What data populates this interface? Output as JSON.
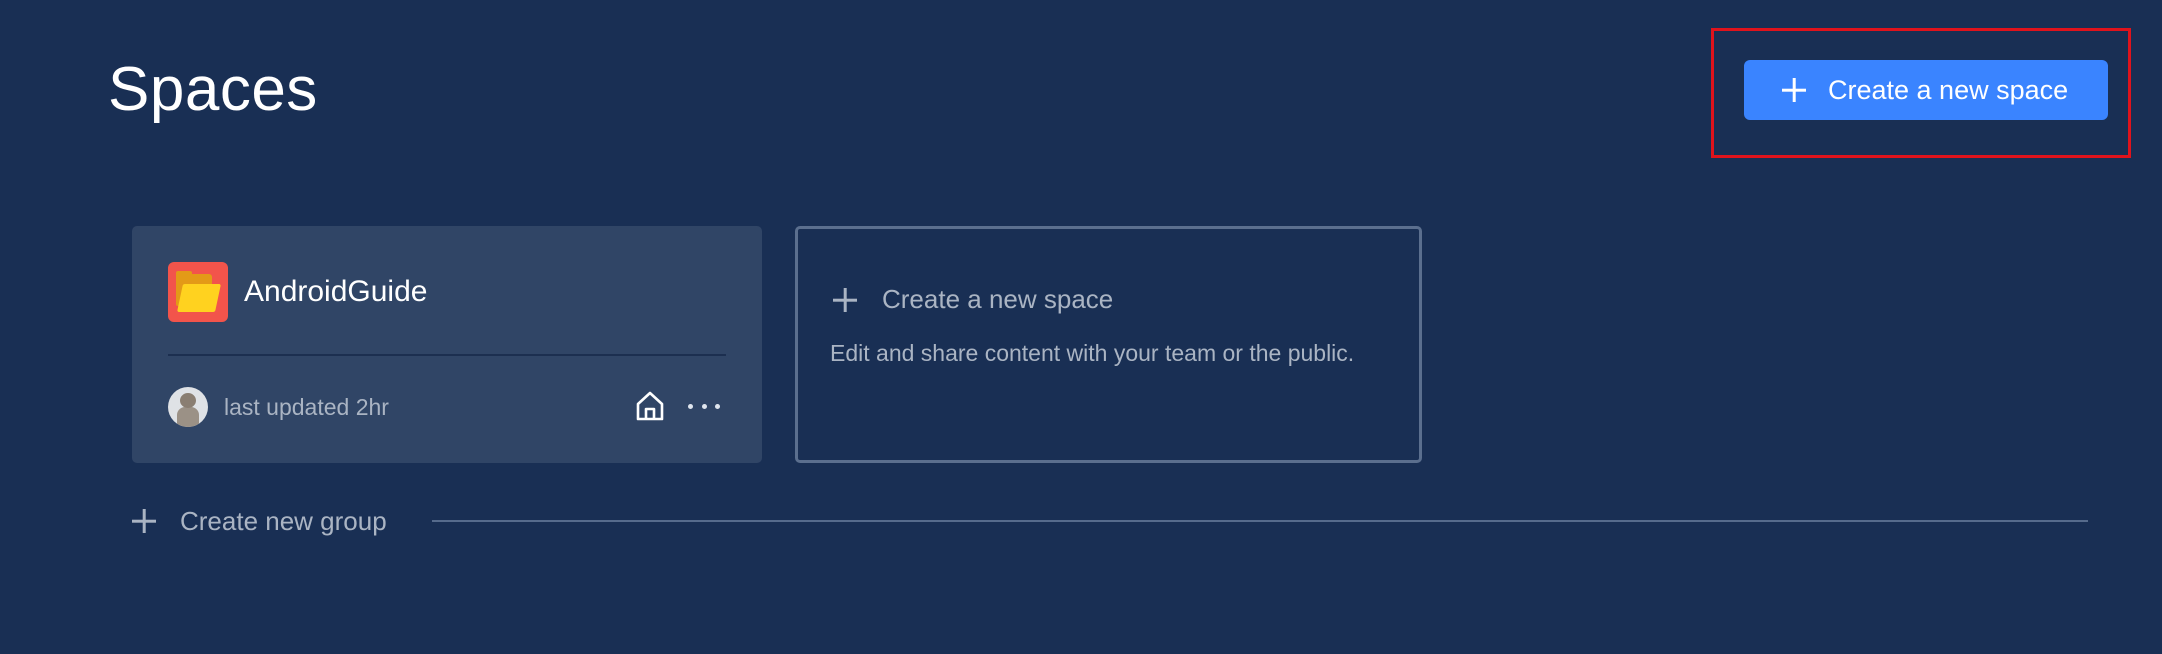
{
  "page": {
    "title": "Spaces"
  },
  "header": {
    "create_button_label": "Create a new space",
    "create_button_icon": "plus-icon",
    "accent_color": "#3a84ff",
    "highlight_color": "#e0131c"
  },
  "spaces": [
    {
      "name": "AndroidGuide",
      "icon": "folder-icon",
      "last_updated": "last updated 2hr",
      "avatar": "user-avatar",
      "actions": [
        "home-icon",
        "more-horizontal-icon"
      ]
    }
  ],
  "create_card": {
    "title": "Create a new space",
    "description": "Edit and share content with your team or the public.",
    "icon": "plus-icon"
  },
  "group": {
    "create_label": "Create new group",
    "icon": "plus-icon"
  },
  "colors": {
    "background": "#192f54",
    "card": "#304566",
    "muted_text": "#aab4c3"
  }
}
